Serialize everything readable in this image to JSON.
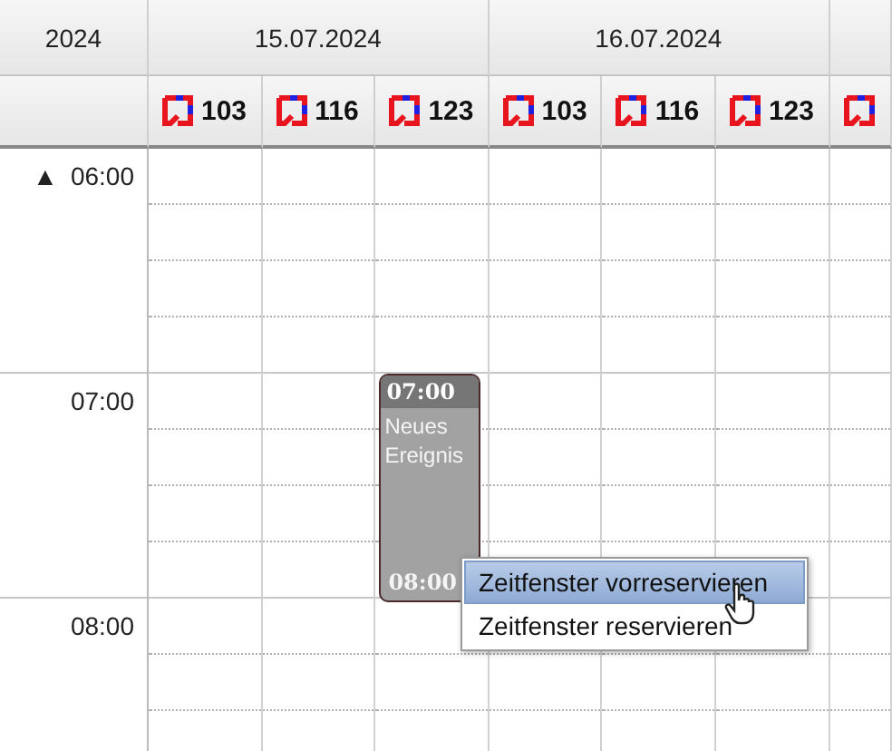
{
  "corner": {
    "year": "2024"
  },
  "days": [
    {
      "date": "15.07.2024"
    },
    {
      "date": "16.07.2024"
    }
  ],
  "resources": [
    {
      "kind": "room",
      "label": "103"
    },
    {
      "kind": "room",
      "label": "116"
    },
    {
      "kind": "room",
      "label": "123",
      "events": [
        {
          "start": "07:00",
          "title": "Neues Ereignis",
          "end": "08:00"
        }
      ]
    },
    {
      "kind": "room",
      "label": "103"
    },
    {
      "kind": "room",
      "label": "116"
    },
    {
      "kind": "room",
      "label": "123"
    },
    {
      "kind": "room"
    }
  ],
  "hours": [
    {
      "label": "06:00",
      "marker": "▲"
    },
    {
      "label": "07:00"
    },
    {
      "label": "08:00"
    }
  ],
  "context_menu": {
    "items": [
      {
        "label": "Zeitfenster vorreservieren",
        "selected": true
      },
      {
        "label": "Zeitfenster reservieren",
        "selected": false
      }
    ]
  }
}
